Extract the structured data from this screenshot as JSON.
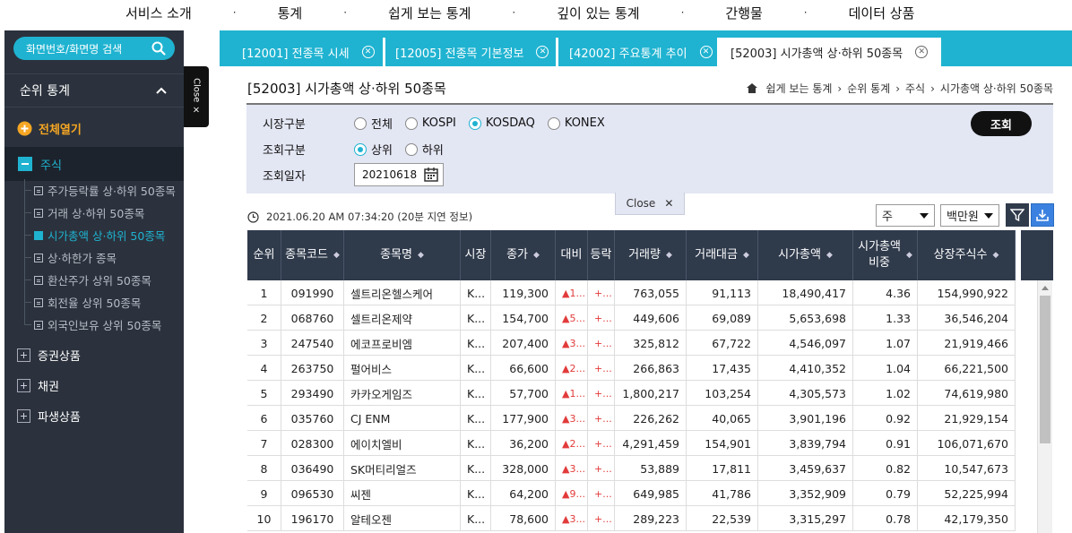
{
  "topnav": [
    "서비스 소개",
    "통계",
    "쉽게 보는 통계",
    "깊이 있는 통계",
    "간행물",
    "데이터 상품"
  ],
  "sidebar": {
    "search_placeholder": "화면번호/화면명 검색",
    "section_title": "순위 통계",
    "open_all": "전체열기",
    "stock_label": "주식",
    "items": [
      {
        "label": "주가등락률 상·하위 50종목",
        "active": false
      },
      {
        "label": "거래 상·하위 50종목",
        "active": false
      },
      {
        "label": "시가총액 상·하위 50종목",
        "active": true
      },
      {
        "label": "상·하한가 종목",
        "active": false
      },
      {
        "label": "환산주가 상위 50종목",
        "active": false
      },
      {
        "label": "회전율 상위 50종목",
        "active": false
      },
      {
        "label": "외국인보유 상위 50종목",
        "active": false
      }
    ],
    "groups": [
      "증권상품",
      "채권",
      "파생상품"
    ],
    "close_tab": "Close ×"
  },
  "tabs": [
    {
      "label": "[12001] 전종목 시세"
    },
    {
      "label": "[12005] 전종목 기본정보"
    },
    {
      "label": "[42002] 주요통계 추이"
    },
    {
      "label": "[52003] 시가총액 상·하위 50종목"
    }
  ],
  "page": {
    "title": "[52003] 시가총액 상·하위 50종목",
    "breadcrumb": [
      "쉽게 보는 통계",
      "순위 통계",
      "주식",
      "시가총액 상·하위 50종목"
    ]
  },
  "filter": {
    "market_label": "시장구분",
    "markets": [
      {
        "label": "전체",
        "on": false
      },
      {
        "label": "KOSPI",
        "on": false
      },
      {
        "label": "KOSDAQ",
        "on": true
      },
      {
        "label": "KONEX",
        "on": false
      }
    ],
    "query_type_label": "조회구분",
    "query_types": [
      {
        "label": "상위",
        "on": true
      },
      {
        "label": "하위",
        "on": false
      }
    ],
    "date_label": "조회일자",
    "date_value": "20210618",
    "search_button": "조회",
    "close_panel": "Close"
  },
  "timestamp": "2021.06.20 AM 07:34:20 (20분 지연 정보)",
  "unit_select": "주",
  "currency_select": "백만원",
  "table": {
    "headers": [
      "순위",
      "종목코드",
      "종목명",
      "시장",
      "종가",
      "대비",
      "등락",
      "거래량",
      "거래대금",
      "시가총액",
      "시가총액\n비중",
      "상장주식수"
    ],
    "rows": [
      [
        "1",
        "091990",
        "셀트리온헬스케어",
        "K...",
        "119,300",
        "▲1...",
        "+...",
        "763,055",
        "91,113",
        "18,490,417",
        "4.36",
        "154,990,922"
      ],
      [
        "2",
        "068760",
        "셀트리온제약",
        "K...",
        "154,700",
        "▲5...",
        "+...",
        "449,606",
        "69,089",
        "5,653,698",
        "1.33",
        "36,546,204"
      ],
      [
        "3",
        "247540",
        "에코프로비엠",
        "K...",
        "207,400",
        "▲3...",
        "+...",
        "325,812",
        "67,722",
        "4,546,097",
        "1.07",
        "21,919,466"
      ],
      [
        "4",
        "263750",
        "펄어비스",
        "K...",
        "66,600",
        "▲2...",
        "+...",
        "266,863",
        "17,435",
        "4,410,352",
        "1.04",
        "66,221,500"
      ],
      [
        "5",
        "293490",
        "카카오게임즈",
        "K...",
        "57,700",
        "▲1...",
        "+...",
        "1,800,217",
        "103,254",
        "4,305,573",
        "1.02",
        "74,619,980"
      ],
      [
        "6",
        "035760",
        "CJ ENM",
        "K...",
        "177,900",
        "▲3...",
        "+...",
        "226,262",
        "40,065",
        "3,901,196",
        "0.92",
        "21,929,154"
      ],
      [
        "7",
        "028300",
        "에이치엘비",
        "K...",
        "36,200",
        "▲2...",
        "+...",
        "4,291,459",
        "154,901",
        "3,839,794",
        "0.91",
        "106,071,670"
      ],
      [
        "8",
        "036490",
        "SK머티리얼즈",
        "K...",
        "328,000",
        "▲3...",
        "+...",
        "53,889",
        "17,811",
        "3,459,637",
        "0.82",
        "10,547,673"
      ],
      [
        "9",
        "096530",
        "씨젠",
        "K...",
        "64,200",
        "▲9...",
        "+...",
        "649,985",
        "41,786",
        "3,352,909",
        "0.79",
        "52,225,994"
      ],
      [
        "10",
        "196170",
        "알테오젠",
        "K...",
        "78,600",
        "▲3...",
        "+...",
        "289,223",
        "22,539",
        "3,315,297",
        "0.78",
        "42,179,350"
      ]
    ]
  }
}
